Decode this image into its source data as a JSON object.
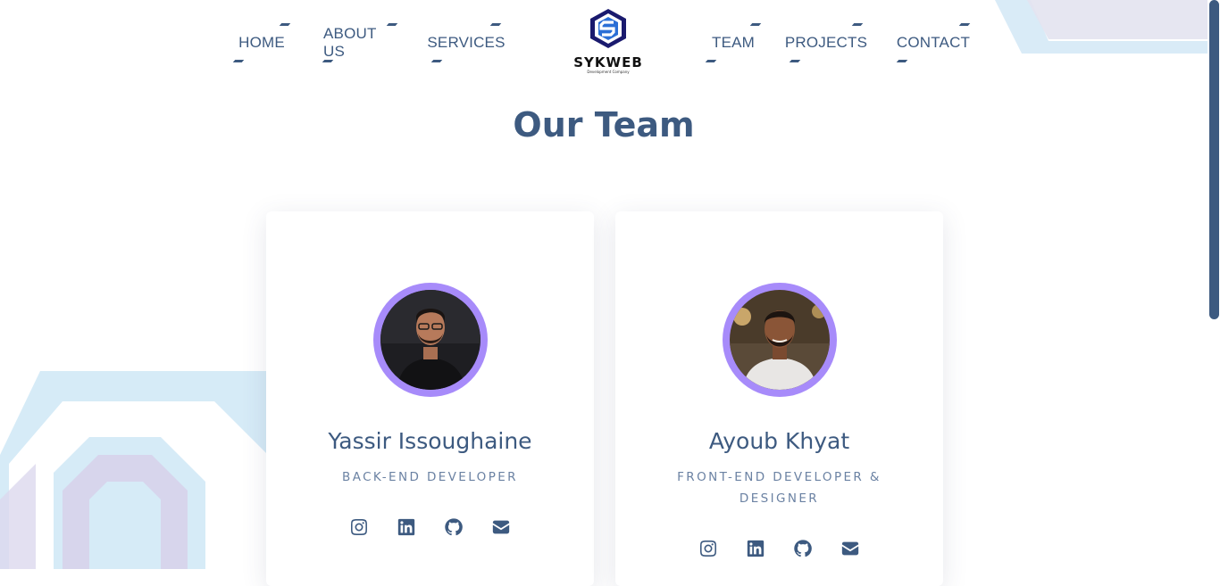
{
  "nav": {
    "left": [
      "HOME",
      "ABOUT US",
      "SERVICES"
    ],
    "right": [
      "TEAM",
      "PROJECTS",
      "CONTACT"
    ],
    "logo_text": "SYKWEB",
    "logo_sub": "Development Company"
  },
  "section": {
    "title": "Our Team"
  },
  "team": [
    {
      "name": "Yassir Issoughaine",
      "role": "BACK-END DEVELOPER"
    },
    {
      "name": "Ayoub Khyat",
      "role": "FRONT-END DEVELOPER & DESIGNER"
    }
  ],
  "social_icons": [
    "instagram-icon",
    "linkedin-icon",
    "github-icon",
    "envelope-icon"
  ],
  "colors": {
    "primary": "#3d5a80",
    "avatar_ring": "#a78bfa",
    "role_text": "#6b82a3"
  }
}
